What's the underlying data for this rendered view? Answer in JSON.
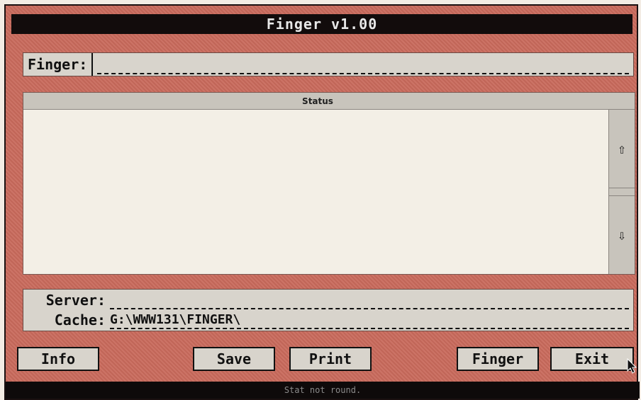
{
  "window": {
    "title": "Finger  v1.00"
  },
  "finger": {
    "label": "Finger:",
    "value": ""
  },
  "status": {
    "header": "Status",
    "content": ""
  },
  "paths": {
    "server_label": "Server:",
    "server_value": "",
    "cache_label": "Cache:",
    "cache_value": "G:\\WWW131\\FINGER\\"
  },
  "buttons": {
    "info": "Info",
    "save": "Save",
    "print": "Print",
    "finger": "Finger",
    "exit": "Exit"
  },
  "statusbar": {
    "text": "Stat not round."
  },
  "icons": {
    "up": "arrow-up-icon",
    "down": "arrow-down-icon",
    "cursor": "mouse-pointer-icon"
  }
}
